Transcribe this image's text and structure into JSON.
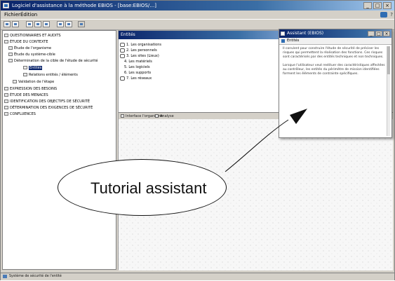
{
  "window": {
    "title": "Logiciel d'assistance à la méthode EBIOS - [base:EBIOS/…]",
    "controls": [
      "_",
      "□",
      "×"
    ]
  },
  "menu": {
    "items": [
      "Fichier",
      "Édition"
    ],
    "help": "?"
  },
  "toolbar": {
    "icons": [
      "new-icon",
      "open-icon",
      "save-icon",
      "print-icon",
      "cut-icon",
      "copy-icon",
      "paste-icon",
      "help-icon"
    ]
  },
  "tree": {
    "items": [
      "QUESTIONNAIRES ET AUDITS",
      "ÉTUDE DU CONTEXTE",
      "Étude de l'organisme",
      "Étude du système-cible",
      "Détermination de la cible de l'étude de sécurité",
      "Entités",
      "Relations entités / éléments",
      "Validation de l'étape",
      "EXPRESSION DES BESOINS",
      "ÉTUDE DES MENACES",
      "IDENTIFICATION DES OBJECTIFS DE SÉCURITÉ",
      "DÉTERMINATION DES EXIGENCES DE SÉCURITÉ",
      "CONFLUENCES"
    ]
  },
  "panel": {
    "title": "Entités",
    "entries": [
      "1. Les organisations",
      "2. Les personnels",
      "3. Les sites (Lieux)",
      "4. Les matériels",
      "5. Les logiciels",
      "6. Les supports",
      "7. Les réseaux"
    ]
  },
  "tabs": {
    "left": "Interface l'organisme",
    "right": "Analyse"
  },
  "assistant": {
    "title": "Assistant (EBIOS)",
    "subtitle": "Entités",
    "paragraph1": "Il convient pour construire l'étude de sécurité de préciser les risques qui permettent la réalisation des fonctions. Ces risques sont caractérisés par des entités techniques et non techniques.",
    "paragraph2": "Lorsque l'utilisateur veut restituer des caractéristiques affectées au contrôleur, les entités du périmètre de mission identifiées forment les éléments de contrainte spécifiques."
  },
  "annotation": {
    "label": "Tutorial assistant"
  },
  "statusbar": {
    "text": "Système de sécurité de l'entité"
  }
}
